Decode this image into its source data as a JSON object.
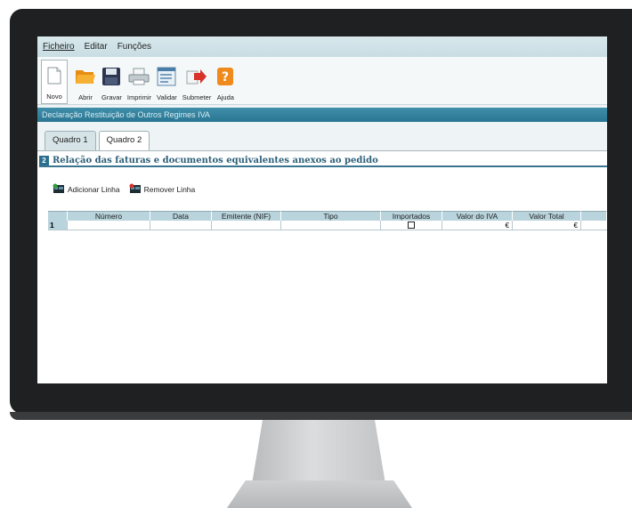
{
  "menu": {
    "items": [
      "Ficheiro",
      "Editar",
      "Funções"
    ]
  },
  "toolbar": {
    "buttons": [
      {
        "label": "Novo",
        "icon": "new-document-icon"
      },
      {
        "label": "Abrir",
        "icon": "folder-open-icon"
      },
      {
        "label": "Gravar",
        "icon": "save-floppy-icon"
      },
      {
        "label": "Imprimir",
        "icon": "printer-icon"
      },
      {
        "label": "Validar",
        "icon": "validate-form-icon"
      },
      {
        "label": "Submeter",
        "icon": "submit-arrow-icon"
      },
      {
        "label": "Ajuda",
        "icon": "help-question-icon"
      }
    ]
  },
  "window": {
    "title": "Declaração Restituição de Outros Regimes IVA"
  },
  "tabs": [
    {
      "label": "Quadro 1",
      "active": false
    },
    {
      "label": "Quadro 2",
      "active": true
    }
  ],
  "section": {
    "number": "2",
    "title": "Relação das faturas e documentos equivalentes anexos ao pedido"
  },
  "row_actions": {
    "add": "Adicionar Linha",
    "remove": "Remover Linha"
  },
  "table": {
    "columns": [
      "Número",
      "Data",
      "Emitente (NIF)",
      "Tipo",
      "Importados",
      "Valor do IVA",
      "Valor Total"
    ],
    "rows": [
      {
        "index": "1",
        "numero": "",
        "data": "",
        "emitente": "",
        "tipo": "",
        "importados": false,
        "valor_iva": "€",
        "valor_total": "€"
      }
    ]
  },
  "colors": {
    "accent": "#2a7693",
    "menu_bg": "#c8dde3",
    "grid_header": "#b9d4dc",
    "icon_orange": "#f0a020",
    "icon_red": "#d8322a"
  }
}
